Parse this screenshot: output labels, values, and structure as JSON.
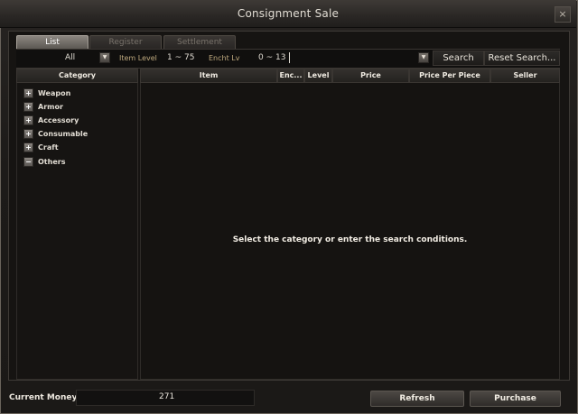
{
  "window": {
    "title": "Consignment Sale",
    "close_icon": "×"
  },
  "tabs": [
    {
      "label": "List",
      "active": true
    },
    {
      "label": "Register",
      "active": false
    },
    {
      "label": "Settlement",
      "active": false
    }
  ],
  "filters": {
    "category_value": "All",
    "item_level_label": "Item Level",
    "item_level_value": "1 ~ 75",
    "encht_label": "Encht Lv",
    "encht_value": "0 ~ 13",
    "search_label": "Search",
    "reset_label": "Reset Search..."
  },
  "category_panel": {
    "header": "Category",
    "items": [
      {
        "label": "Weapon",
        "toggle": "+"
      },
      {
        "label": "Armor",
        "toggle": "+"
      },
      {
        "label": "Accessory",
        "toggle": "+"
      },
      {
        "label": "Consumable",
        "toggle": "+"
      },
      {
        "label": "Craft",
        "toggle": "+"
      },
      {
        "label": "Others",
        "toggle": "−"
      }
    ]
  },
  "list_headers": {
    "item": "Item",
    "ench": "Enc...",
    "level": "Level",
    "price": "Price",
    "price_per_piece": "Price Per Piece",
    "seller": "Seller"
  },
  "empty_message": "Select the category or enter the search conditions.",
  "footer": {
    "current_money_label": "Current Money",
    "current_money_value": "271",
    "refresh_label": "Refresh",
    "purchase_label": "Purchase"
  }
}
